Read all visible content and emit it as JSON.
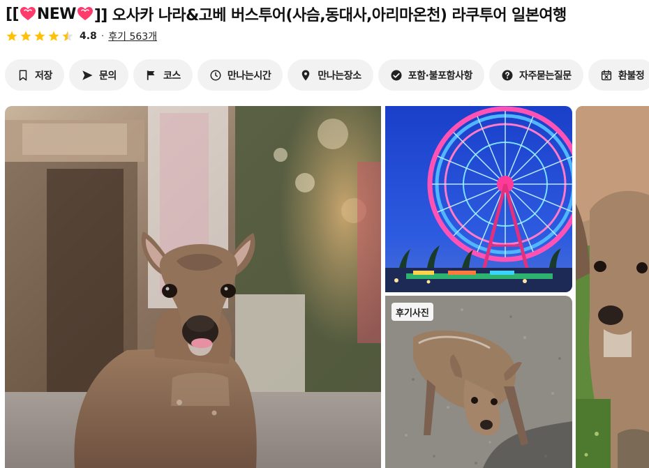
{
  "product": {
    "title_prefix": "[[",
    "title_new": "NEW",
    "title_main": "]] 오사카 나라&고베 버스투어(사슴,동대사,아리마온천) 라쿠투어 일본여행",
    "rating_value": "4.8",
    "rating_stars": 4.5,
    "rating_separator": "·",
    "reviews_label": "후기 563개"
  },
  "chips": [
    {
      "label": "저장",
      "icon": "bookmark-icon"
    },
    {
      "label": "문의",
      "icon": "send-icon"
    },
    {
      "label": "코스",
      "icon": "flag-icon"
    },
    {
      "label": "만나는시간",
      "icon": "clock-icon"
    },
    {
      "label": "만나는장소",
      "icon": "location-pin-icon"
    },
    {
      "label": "포함·불포함사항",
      "icon": "check-circle-icon"
    },
    {
      "label": "자주묻는질문",
      "icon": "question-circle-icon"
    },
    {
      "label": "환불정",
      "icon": "calendar-x-icon"
    }
  ],
  "gallery": {
    "review_badge": "후기사진"
  },
  "colors": {
    "star": "#ffc107",
    "chip_bg": "#f2f2f3",
    "heart": "#ff3b6b"
  }
}
